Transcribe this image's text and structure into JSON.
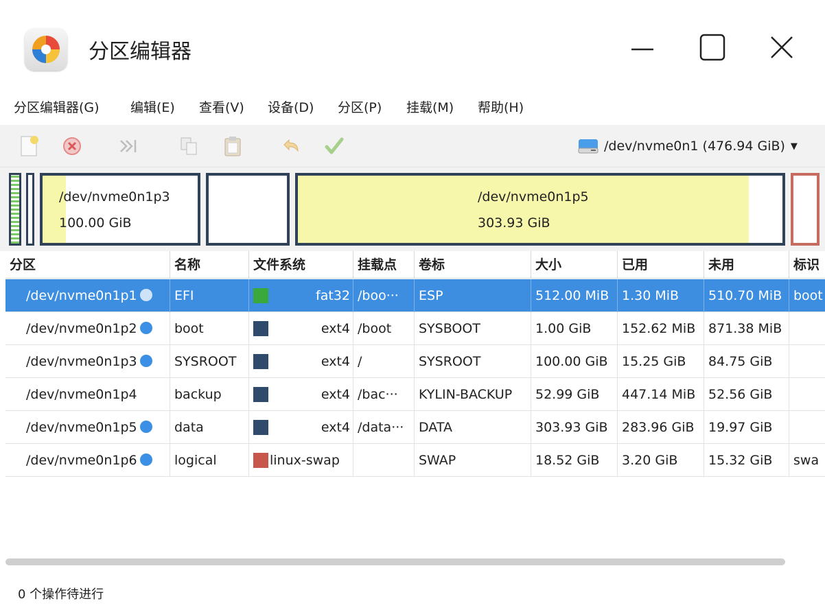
{
  "window": {
    "title": "分区编辑器",
    "app_icon": "gparted-icon"
  },
  "menu": [
    "分区编辑器(G)",
    "编辑(E)",
    "查看(V)",
    "设备(D)",
    "分区(P)",
    "挂载(M)",
    "帮助(H)"
  ],
  "toolbar": {
    "buttons": [
      "new-partition-icon",
      "delete-icon",
      "resize-move-icon",
      "copy-icon",
      "paste-icon",
      "undo-icon",
      "apply-icon"
    ],
    "device": "/dev/nvme0n1 (476.94 GiB)"
  },
  "partition_map": {
    "p3": {
      "name": "/dev/nvme0n1p3",
      "size": "100.00 GiB",
      "used_fraction": 0.15
    },
    "p5": {
      "name": "/dev/nvme0n1p5",
      "size": "303.93 GiB",
      "used_fraction": 0.93
    }
  },
  "table": {
    "columns": [
      "分区",
      "名称",
      "文件系统",
      "挂载点",
      "卷标",
      "大小",
      "已用",
      "未用",
      "标识"
    ],
    "rows": [
      {
        "partition": "/dev/nvme0n1p1",
        "locked": true,
        "name": "EFI",
        "fs": "fat32",
        "fs_color": "#3aa83a",
        "mount": "/boo···",
        "label": "ESP",
        "size": "512.00 MiB",
        "used": "1.30 MiB",
        "unused": "510.70 MiB",
        "flags": "boot",
        "selected": true
      },
      {
        "partition": "/dev/nvme0n1p2",
        "locked": true,
        "name": "boot",
        "fs": "ext4",
        "fs_color": "#2f4a6b",
        "mount": "/boot",
        "label": "SYSBOOT",
        "size": "1.00 GiB",
        "used": "152.62 MiB",
        "unused": "871.38 MiB",
        "flags": ""
      },
      {
        "partition": "/dev/nvme0n1p3",
        "locked": true,
        "name": "SYSROOT",
        "fs": "ext4",
        "fs_color": "#2f4a6b",
        "mount": "/",
        "label": "SYSROOT",
        "size": "100.00 GiB",
        "used": "15.25 GiB",
        "unused": "84.75 GiB",
        "flags": ""
      },
      {
        "partition": "/dev/nvme0n1p4",
        "locked": false,
        "name": "backup",
        "fs": "ext4",
        "fs_color": "#2f4a6b",
        "mount": "/bac···",
        "label": "KYLIN-BACKUP",
        "size": "52.99 GiB",
        "used": "447.14 MiB",
        "unused": "52.56 GiB",
        "flags": ""
      },
      {
        "partition": "/dev/nvme0n1p5",
        "locked": true,
        "name": "data",
        "fs": "ext4",
        "fs_color": "#2f4a6b",
        "mount": "/data···",
        "label": "DATA",
        "size": "303.93 GiB",
        "used": "283.96 GiB",
        "unused": "19.97 GiB",
        "flags": ""
      },
      {
        "partition": "/dev/nvme0n1p6",
        "locked": true,
        "name": "logical",
        "fs": "linux-swap",
        "fs_color": "#c8564d",
        "mount": "",
        "label": "SWAP",
        "size": "18.52 GiB",
        "used": "3.20 GiB",
        "unused": "15.32 GiB",
        "flags": "swa"
      }
    ]
  },
  "status": "0 个操作待进行"
}
